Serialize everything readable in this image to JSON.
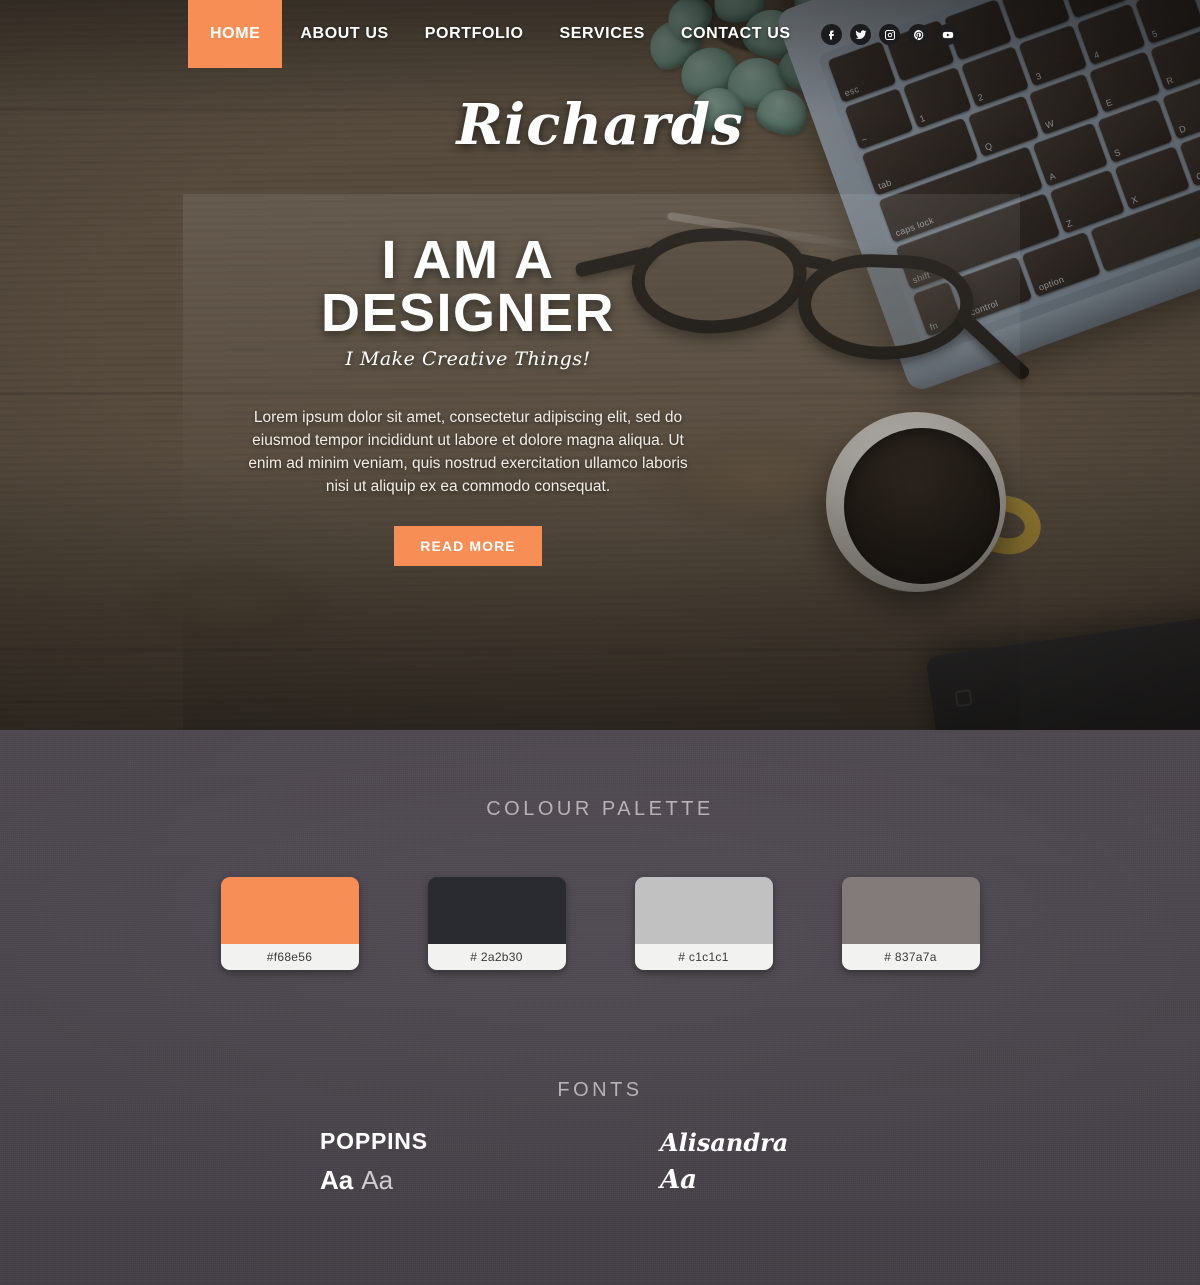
{
  "nav": {
    "items": [
      {
        "label": "HOME",
        "active": true
      },
      {
        "label": "ABOUT US",
        "active": false
      },
      {
        "label": "PORTFOLIO",
        "active": false
      },
      {
        "label": "SERVICES",
        "active": false
      },
      {
        "label": "CONTACT US",
        "active": false
      }
    ],
    "social": [
      {
        "name": "facebook-icon",
        "glyph": "f"
      },
      {
        "name": "twitter-icon",
        "glyph": "t"
      },
      {
        "name": "instagram-icon",
        "glyph": "i"
      },
      {
        "name": "pinterest-icon",
        "glyph": "p"
      },
      {
        "name": "youtube-icon",
        "glyph": "y"
      }
    ]
  },
  "logo": {
    "text": "Richards"
  },
  "hero": {
    "title_line1": "I AM A",
    "title_line2": "DESIGNER",
    "tagline": "I Make Creative Things!",
    "body": "Lorem ipsum dolor sit amet, consectetur adipiscing elit, sed do eiusmod tempor incididunt ut labore et dolore magna aliqua. Ut enim ad minim veniam, quis nostrud exercitation ullamco laboris nisi ut aliquip ex ea commodo consequat.",
    "cta_label": "READ MORE"
  },
  "palette": {
    "heading": "COLOUR PALETTE",
    "swatches": [
      {
        "code": "#f68e56",
        "hex": "#f68e56"
      },
      {
        "code": "# 2a2b30",
        "hex": "#2a2b30"
      },
      {
        "code": "# c1c1c1",
        "hex": "#c1c1c1"
      },
      {
        "code": "# 837a7a",
        "hex": "#837a7a"
      }
    ]
  },
  "fonts": {
    "heading": "FONTS",
    "items": [
      {
        "name": "POPPINS",
        "sample_bold": "Aa",
        "sample_regular": "Aa",
        "style": "sans"
      },
      {
        "name": "Alisandra",
        "sample_bold": "Aa",
        "sample_regular": "",
        "style": "script"
      }
    ]
  },
  "colors": {
    "accent": "#f68e56",
    "dark": "#2a2b30",
    "light_gray": "#c1c1c1",
    "warm_gray": "#837a7a",
    "guide_bg": "#4a444c"
  }
}
